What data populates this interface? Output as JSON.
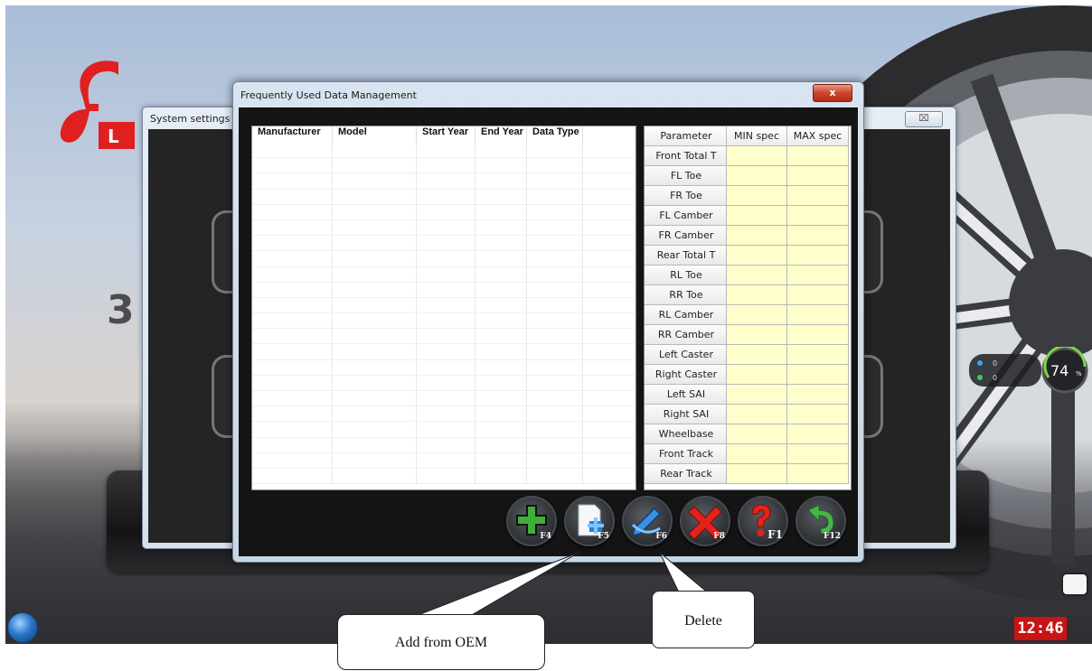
{
  "desktop": {
    "big_digit": "3",
    "clock": "12:46",
    "gauge_percent": "74",
    "gauge_unit": "%",
    "gauge_line1": "0",
    "gauge_line2": "0"
  },
  "system_window": {
    "title": "System settings",
    "close_glyph": "⌧"
  },
  "dialog": {
    "title": "Frequently Used Data Management",
    "close_glyph": "x"
  },
  "vehicle_table": {
    "columns": [
      "Manufacturer",
      "Model",
      "Start Year",
      "End Year",
      "Data Type",
      ""
    ],
    "rows": []
  },
  "spec_table": {
    "columns": [
      "Parameter",
      "MIN spec",
      "MAX spec"
    ],
    "parameters": [
      "Front Total T",
      "FL Toe",
      "FR Toe",
      "FL Camber",
      "FR Camber",
      "Rear Total T",
      "RL Toe",
      "RR Toe",
      "RL Camber",
      "RR Camber",
      "Left Caster",
      "Right Caster",
      "Left SAI",
      "Right SAI",
      "Wheelbase",
      "Front Track",
      "Rear Track"
    ]
  },
  "toolbar": {
    "buttons": [
      {
        "name": "add-button",
        "key": "F4",
        "icon": "plus-icon"
      },
      {
        "name": "add-from-oem-button",
        "key": "F5",
        "icon": "document-add-icon"
      },
      {
        "name": "edit-button",
        "key": "F6",
        "icon": "pencil-icon"
      },
      {
        "name": "delete-button",
        "key": "F8",
        "icon": "red-x-icon"
      },
      {
        "name": "help-button",
        "key": "F1",
        "icon": "help-icon"
      },
      {
        "name": "return-button",
        "key": "F12",
        "icon": "return-arrow-icon"
      }
    ]
  },
  "callouts": {
    "add_from_oem": "Add from OEM",
    "delete": "Delete"
  },
  "colors": {
    "spec_cell": "#ffffcc",
    "logo_red": "#e02020",
    "close_red": "#c8452b",
    "clock_bg": "#c81414"
  }
}
